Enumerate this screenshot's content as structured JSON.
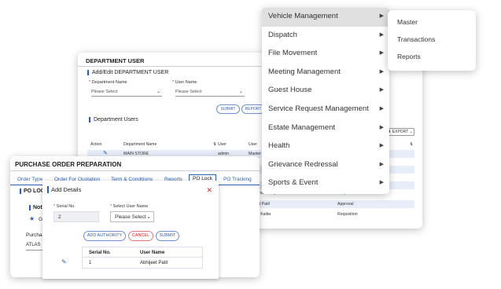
{
  "dept": {
    "title": "DEPARTMENT USER",
    "add_edit_title": "Add/Edit DEPARTMENT USER",
    "department_name_label": "Department Name",
    "department_name_value": "Please Select",
    "user_name_label": "User Name",
    "user_name_value": "Please Select",
    "submit_label": "SUBMIT",
    "report_label": "REPORT",
    "dept_users_title": "Department Users",
    "export_label": "EXPORT",
    "columns": [
      "Action",
      "Department Name",
      "User",
      "User"
    ],
    "rows": [
      {
        "dept": "MAIN STORE",
        "user": "admin",
        "user2": "Master"
      },
      {
        "dept": "",
        "user": "",
        "user2": "h Chaudhary",
        "role": "Requisition"
      },
      {
        "dept": "",
        "user": "",
        "user2": "eet Patil",
        "role": "Approval"
      },
      {
        "dept": "",
        "user": "",
        "user2": "hu Kalita",
        "role": "Requisition"
      }
    ]
  },
  "po": {
    "title": "PURCHASE ORDER PREPARATION",
    "tabs": [
      "Order Type",
      "Order For Quotation",
      "Term & Conditions",
      "Reports",
      "PO Lock",
      "PO Tracking"
    ],
    "po_lock_title": "PO LOCK",
    "note_title": "Not",
    "star_item": "G",
    "purchase_label": "Purcha",
    "purchase_value": "ATLAS"
  },
  "modal": {
    "title": "Add Details",
    "serial_label": "Serial No.",
    "serial_value": "2",
    "user_label": "Select User Name",
    "user_value": "Please Select",
    "add_authority": "ADD AUTHORITY",
    "cancel": "CANCEL",
    "submit": "SUBMIT",
    "table_headers": [
      "Serial No.",
      "User Name"
    ],
    "table_rows": [
      {
        "serial": "1",
        "user": "Abhijeet Patil"
      }
    ]
  },
  "menu": {
    "items": [
      "Vehicle Management",
      "Dispatch",
      "File Movement",
      "Meeting Management",
      "Guest House",
      "Service Request Management",
      "Estate Management",
      "Health",
      "Grievance Redressal",
      "Sports & Event"
    ],
    "active_index": 0,
    "submenu": [
      "Master",
      "Transactions",
      "Reports"
    ]
  }
}
